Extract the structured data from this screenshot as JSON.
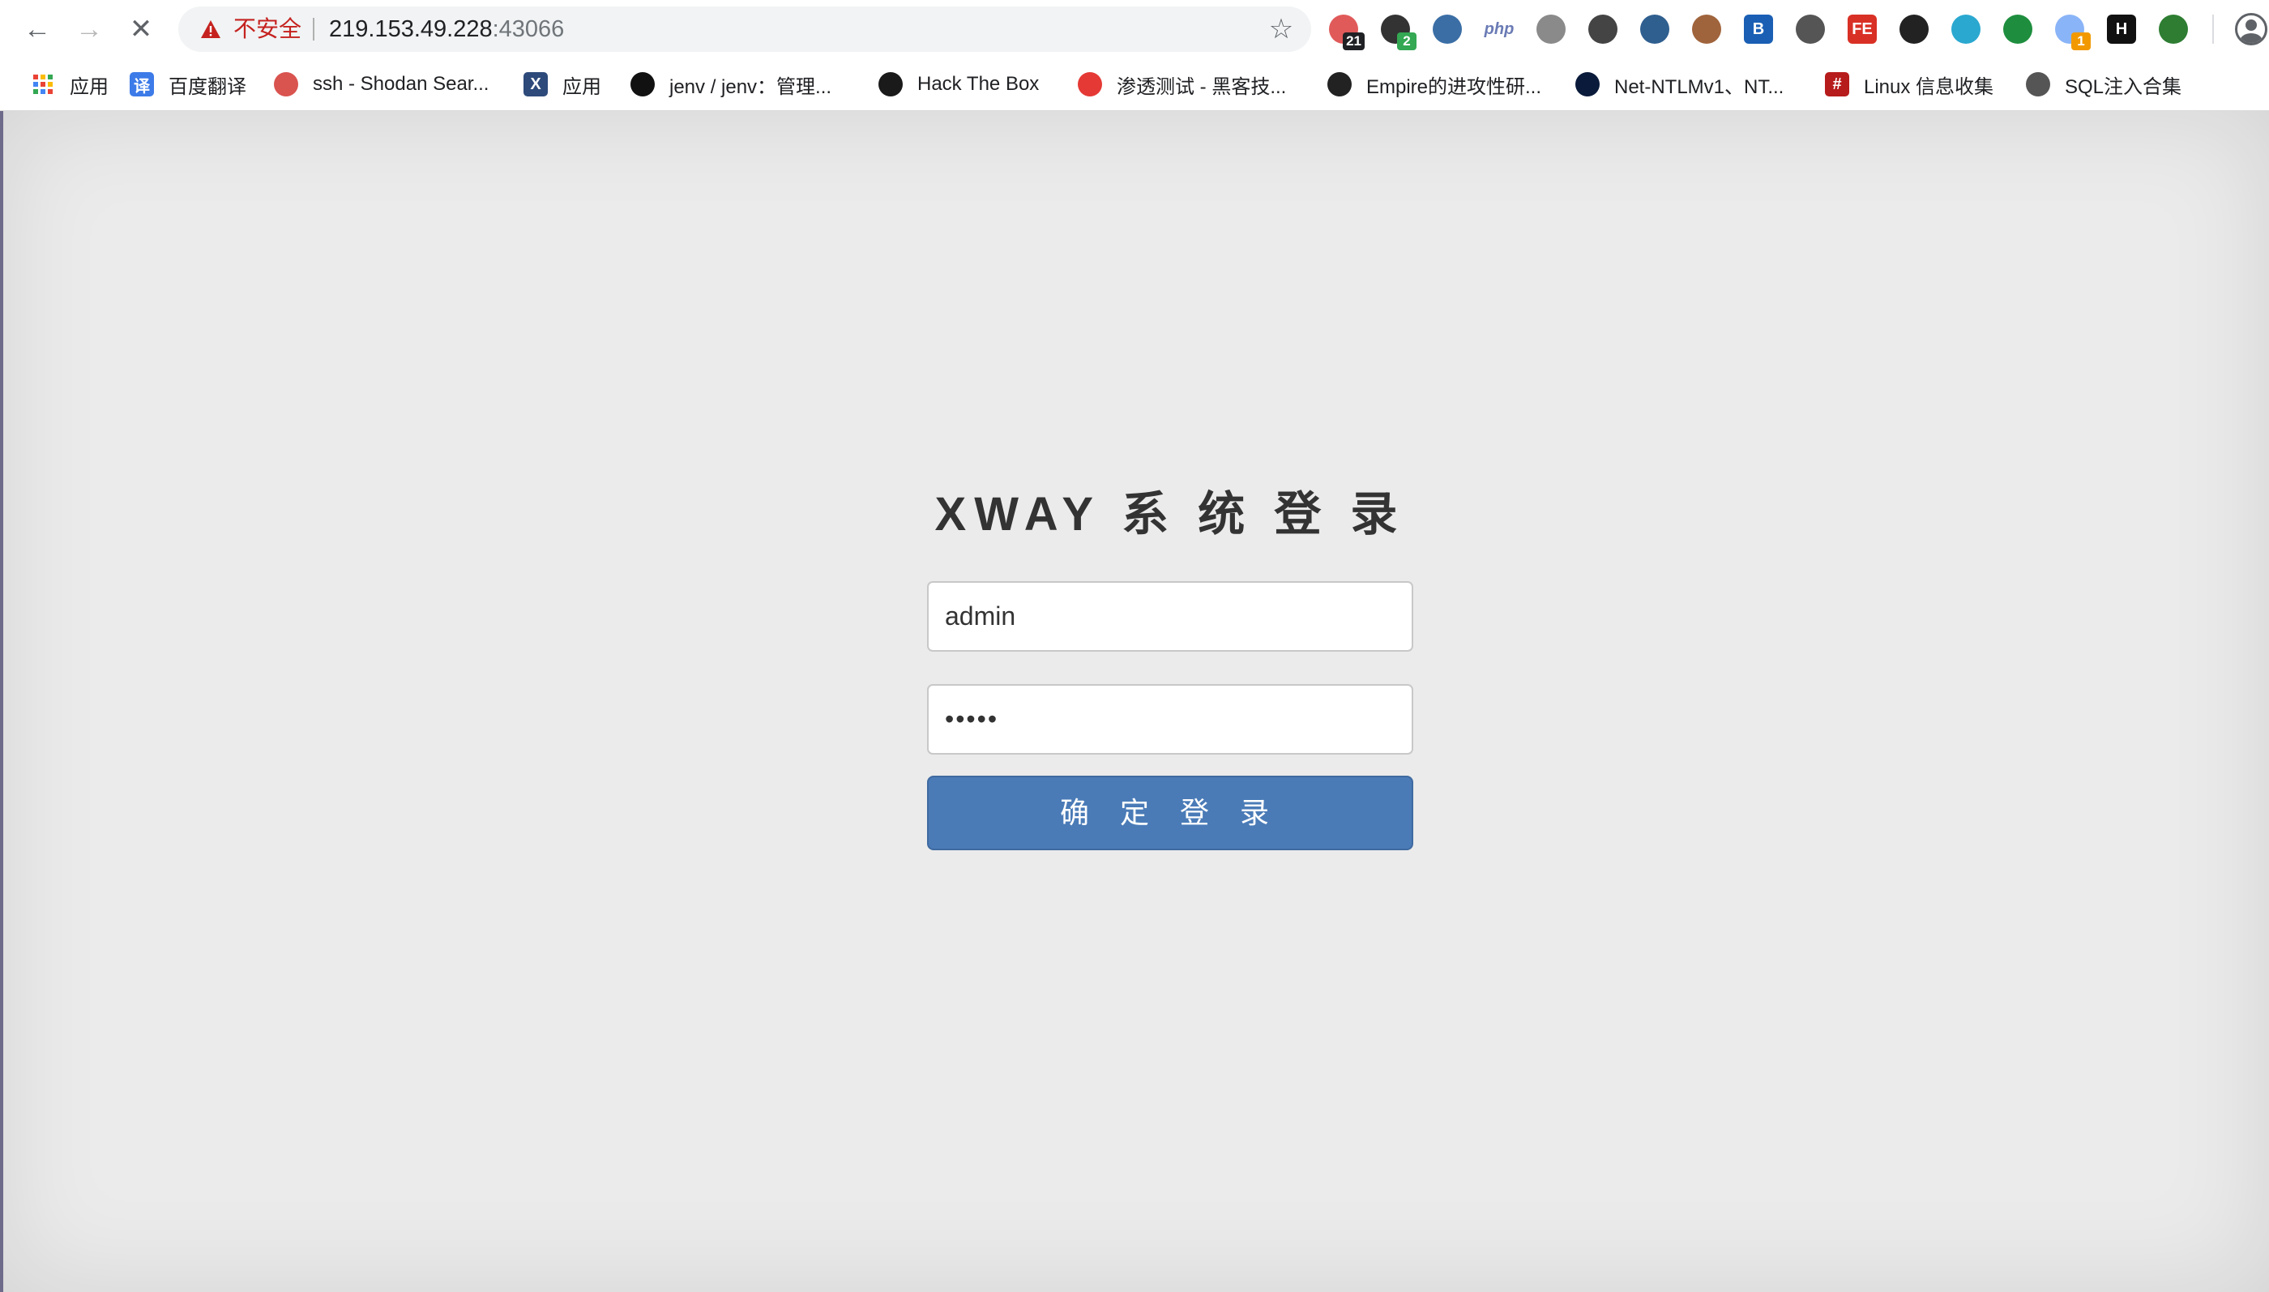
{
  "browser": {
    "back_icon": "←",
    "forward_icon": "→",
    "stop_icon": "✕",
    "security_label": "不安全",
    "url_host": "219.153.49.228",
    "url_port": ":43066",
    "star_icon": "☆"
  },
  "extensions": [
    {
      "name": "ext-1",
      "badge": "21",
      "color": "#e05a5a"
    },
    {
      "name": "ext-2",
      "badge": "2",
      "color": "#333333"
    },
    {
      "name": "ext-3",
      "badge": "",
      "color": "#3b6ea5"
    },
    {
      "name": "ext-php",
      "label": "php",
      "color": "#6a7bb5"
    },
    {
      "name": "ext-5",
      "badge": "",
      "color": "#8a8a8a"
    },
    {
      "name": "ext-6",
      "badge": "",
      "color": "#444444"
    },
    {
      "name": "ext-7",
      "badge": "",
      "color": "#2f5f8f"
    },
    {
      "name": "ext-8",
      "badge": "",
      "color": "#a0643c"
    },
    {
      "name": "ext-B",
      "label": "B",
      "color": "#1a5fb4"
    },
    {
      "name": "ext-10",
      "badge": "",
      "color": "#555555"
    },
    {
      "name": "ext-FE",
      "label": "FE",
      "color": "#d93025"
    },
    {
      "name": "ext-12",
      "badge": "",
      "color": "#222222"
    },
    {
      "name": "ext-13",
      "badge": "",
      "color": "#2aa8d0"
    },
    {
      "name": "ext-14",
      "badge": "",
      "color": "#1e8e3e"
    },
    {
      "name": "ext-15",
      "badge": "1",
      "color": "#8ab4f8"
    },
    {
      "name": "ext-H",
      "label": "H",
      "color": "#111111"
    },
    {
      "name": "ext-17",
      "badge": "",
      "color": "#2e7d32"
    }
  ],
  "bookmarks": [
    {
      "label": "应用",
      "icon": "apps-grid-icon",
      "color": "#ffffff"
    },
    {
      "label": "百度翻译",
      "icon": "译",
      "color": "#3c7be8"
    },
    {
      "label": "ssh - Shodan Sear...",
      "icon": "shodan-icon",
      "color": "#d9534f"
    },
    {
      "label": "应用",
      "icon": "X",
      "color": "#2d4a7a"
    },
    {
      "label": "jenv / jenv：管理...",
      "icon": "github-icon",
      "color": "#111111"
    },
    {
      "label": "Hack The Box",
      "icon": "htb-icon",
      "color": "#1a1a1a"
    },
    {
      "label": "渗透测试 - 黑客技...",
      "icon": "vulnhub-icon",
      "color": "#e53935"
    },
    {
      "label": "Empire的进攻性研...",
      "icon": "empire-icon",
      "color": "#222222"
    },
    {
      "label": "Net-NTLMv1、NT...",
      "icon": "ntlm-icon",
      "color": "#0a1a3a"
    },
    {
      "label": "Linux 信息收集",
      "icon": "#",
      "color": "#b71c1c"
    },
    {
      "label": "SQL注入合集",
      "icon": "globe-icon",
      "color": "#555555"
    }
  ],
  "login": {
    "title": "XWAY 系 统 登 录",
    "username_value": "admin",
    "password_value": "•••••",
    "submit_label": "确 定 登 录"
  }
}
